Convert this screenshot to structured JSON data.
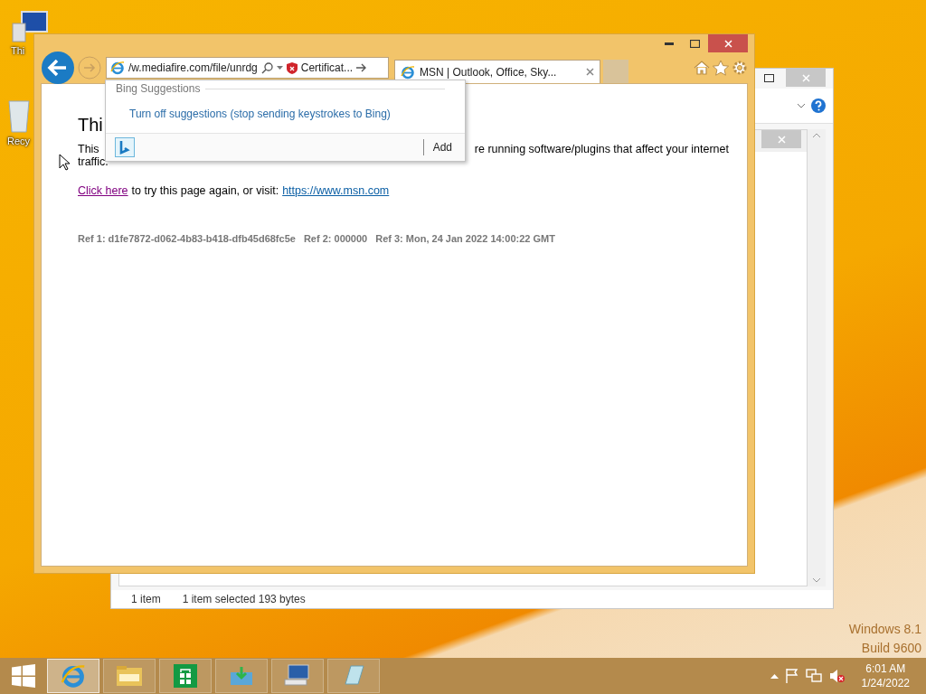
{
  "desktop_icons": [
    {
      "kind": "computer",
      "label": "Thi"
    },
    {
      "kind": "recycle",
      "label": "Recy"
    }
  ],
  "background_window": {
    "status_items": [
      "1 item",
      "1 item selected  193 bytes"
    ]
  },
  "browser": {
    "address": "/w.mediafire.com/file/unrdg",
    "certificate": "Certificat...",
    "tabs": [
      {
        "label": "MSN | Outlook, Office, Sky...",
        "selected": true
      }
    ],
    "suggestions": {
      "heading": "Bing Suggestions",
      "link": "Turn off suggestions (stop sending keystrokes to Bing)",
      "add": "Add"
    },
    "page": {
      "title": "Thi",
      "line1_start": "This",
      "line1_end": "re running software/plugins that affect your internet",
      "line2": "traffic.",
      "retry_link": "Click here",
      "retry_text": "to try this page again, or visit:",
      "msn_link": "https://www.msn.com",
      "refs": [
        "Ref 1: d1fe7872-d062-4b83-b418-dfb45d68fc5e",
        "Ref 2: 000000",
        "Ref 3: Mon, 24 Jan 2022 14:00:22 GMT"
      ]
    }
  },
  "os_watermark": [
    "Windows 8.1",
    "Build 9600"
  ],
  "taskbar": {
    "apps": [
      {
        "kind": "browser",
        "selected": true
      },
      {
        "kind": "folder",
        "selected": false
      },
      {
        "kind": "store",
        "selected": false
      },
      {
        "kind": "installer",
        "selected": false
      },
      {
        "kind": "computer",
        "selected": false
      },
      {
        "kind": "notepad",
        "selected": false
      }
    ],
    "time": "6:01 AM",
    "date": "1/24/2022"
  }
}
